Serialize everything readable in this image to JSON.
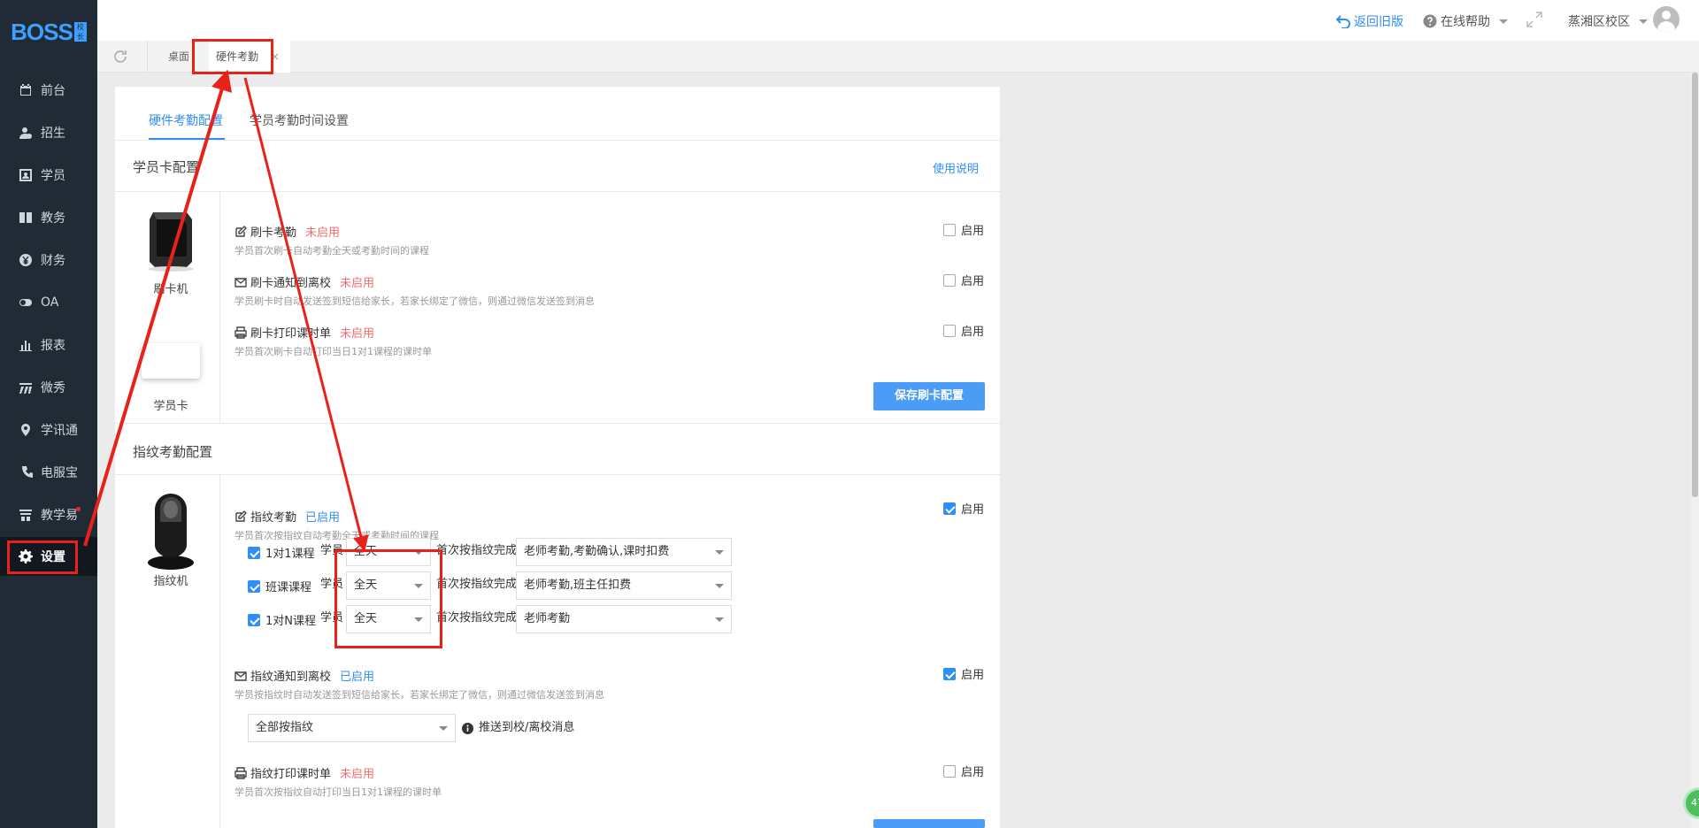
{
  "brand": {
    "logo_text": "BOSS",
    "logo_badge": "校长"
  },
  "sidebar": {
    "items": [
      {
        "label": "前台",
        "icon": "calendar-icon"
      },
      {
        "label": "招生",
        "icon": "user-add-icon"
      },
      {
        "label": "学员",
        "icon": "id-card-icon"
      },
      {
        "label": "教务",
        "icon": "book-icon"
      },
      {
        "label": "财务",
        "icon": "yen-icon"
      },
      {
        "label": "OA",
        "icon": "toggle-icon"
      },
      {
        "label": "报表",
        "icon": "bar-chart-icon"
      },
      {
        "label": "微秀",
        "icon": "wave-icon"
      },
      {
        "label": "学讯通",
        "icon": "location-icon"
      },
      {
        "label": "电服宝",
        "icon": "phone-icon"
      },
      {
        "label": "教学易",
        "icon": "teach-icon"
      },
      {
        "label": "设置",
        "icon": "gear-icon"
      }
    ],
    "active": "设置"
  },
  "topbar": {
    "back_old": "返回旧版",
    "help": "在线帮助",
    "campus": "蒸湘区校区"
  },
  "tabs": {
    "home": "桌面",
    "current": "硬件考勤",
    "close": "×"
  },
  "subtabs": {
    "hardware": "硬件考勤配置",
    "time": "学员考勤时间设置"
  },
  "card_section": {
    "title": "学员卡配置",
    "help_link": "使用说明",
    "devices": {
      "reader": "刷卡机",
      "card": "学员卡"
    },
    "features": [
      {
        "name": "刷卡考勤",
        "status": "未启用",
        "desc": "学员首次刷卡自动考勤全天或考勤时间的课程",
        "enable_label": "启用",
        "enabled": false
      },
      {
        "name": "刷卡通知到离校",
        "status": "未启用",
        "desc": "学员刷卡时自动发送签到短信给家长，若家长绑定了微信，则通过微信发送签到消息",
        "enable_label": "启用",
        "enabled": false
      },
      {
        "name": "刷卡打印课时单",
        "status": "未启用",
        "desc": "学员首次刷卡自动打印当日1对1课程的课时单",
        "enable_label": "启用",
        "enabled": false
      }
    ],
    "save_button": "保存刷卡配置"
  },
  "finger_section": {
    "title": "指纹考勤配置",
    "device": "指纹机",
    "attendance": {
      "name": "指纹考勤",
      "status": "已启用",
      "desc": "学员首次按指纹自动考勤全天或考勤时间的课程",
      "enable_label": "启用",
      "enabled": true
    },
    "courses": [
      {
        "label": "1对1课程",
        "checked": true,
        "prefix": "学员",
        "time": "全天",
        "mid": "首次按指纹完成",
        "action": "老师考勤,考勤确认,课时扣费"
      },
      {
        "label": "班课课程",
        "checked": true,
        "prefix": "学员",
        "time": "全天",
        "mid": "首次按指纹完成",
        "action": "老师考勤,班主任扣费"
      },
      {
        "label": "1对N课程",
        "checked": true,
        "prefix": "学员",
        "time": "全天",
        "mid": "首次按指纹完成",
        "action": "老师考勤"
      }
    ],
    "notify": {
      "name": "指纹通知到离校",
      "status": "已启用",
      "desc": "学员按指纹时自动发送签到短信给家长，若家长绑定了微信，则通过微信发送签到消息",
      "enable_label": "启用",
      "enabled": true
    },
    "notify_select": "全部按指纹",
    "notify_hint": "推送到校/离校消息",
    "print": {
      "name": "指纹打印课时单",
      "status": "未启用",
      "desc": "学员首次按指纹自动打印当日1对1课程的课时单",
      "enable_label": "启用",
      "enabled": false
    }
  },
  "float_badge": "47",
  "colors": {
    "sidebar_bg": "#212b36",
    "accent": "#2f8ef7",
    "danger": "#f56c6c",
    "annotation": "#e8221b"
  }
}
